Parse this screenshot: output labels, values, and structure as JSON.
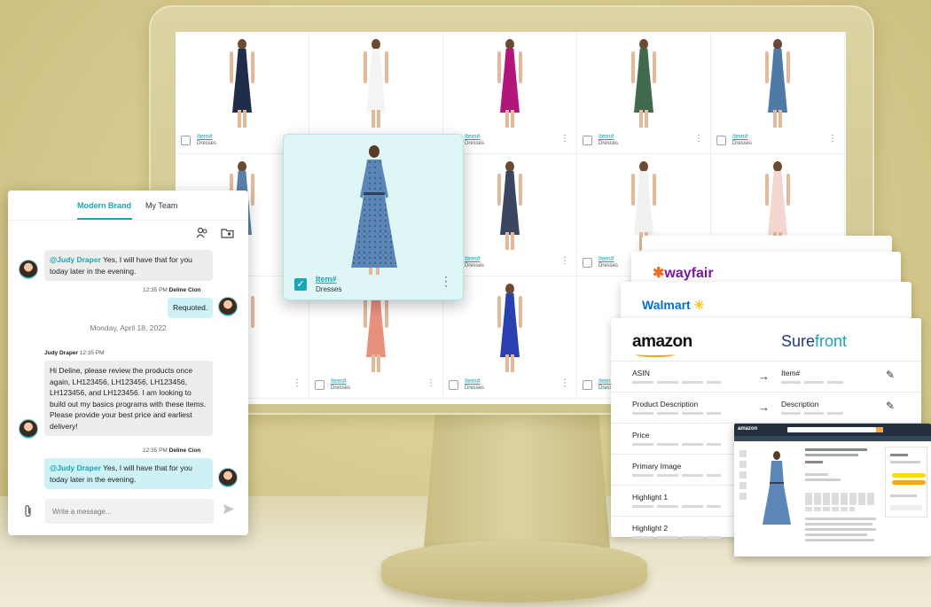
{
  "grid": {
    "tiles": [
      {
        "name": "Item#",
        "category": "Dresses",
        "color": "#1f2d4a",
        "skin": "#e3b99a"
      },
      {
        "name": "Item#",
        "category": "Dresses",
        "color": "#f4f4f2",
        "skin": "#e3b99a"
      },
      {
        "name": "Item#",
        "category": "Dresses",
        "color": "#b3167a",
        "skin": "#e3b99a"
      },
      {
        "name": "Item#",
        "category": "Dresses",
        "color": "#3f6a4e",
        "skin": "#e3b99a"
      },
      {
        "name": "Item#",
        "category": "Dresses",
        "color": "#4f7aa6",
        "skin": "#e3b99a"
      },
      {
        "name": "Item#",
        "category": "Dresses",
        "color": "#5a7fa8",
        "skin": "#e3b99a"
      },
      {
        "name": "Item#",
        "category": "Dresses",
        "color": "#ffffff",
        "skin": "#e3b99a"
      },
      {
        "name": "Item#",
        "category": "Dresses",
        "color": "#3a4660",
        "skin": "#e3b99a"
      },
      {
        "name": "Item#",
        "category": "Dresses",
        "color": "#f1f1ef",
        "skin": "#e3b99a"
      },
      {
        "name": "Item#",
        "category": "Dresses",
        "color": "#f3d6d0",
        "skin": "#e3b99a"
      },
      {
        "name": "Item#",
        "category": "Dresses",
        "color": "#ffffff",
        "skin": "#e3b99a"
      },
      {
        "name": "Item#",
        "category": "Dresses",
        "color": "#e98f7e",
        "skin": "#e3b99a"
      },
      {
        "name": "Item#",
        "category": "Dresses",
        "color": "#2a3fb0",
        "skin": "#e3b99a"
      },
      {
        "name": "Item#",
        "category": "Dresses",
        "color": "#ffffff",
        "skin": "#e3b99a"
      },
      {
        "name": "Item#",
        "category": "Dresses",
        "color": "#ffffff",
        "skin": "#e3b99a"
      }
    ]
  },
  "selected_card": {
    "name": "Item#",
    "category": "Dresses",
    "checked": true
  },
  "chat": {
    "tabs": [
      "Modern Brand",
      "My Team"
    ],
    "active_tab": "Modern Brand",
    "messages": [
      {
        "mention": "@Judy Draper",
        "text": " Yes, I will have that for you today later in the evening."
      },
      {
        "time": "12:35 PM",
        "sender": "Deline Cion",
        "text": "Requoted."
      },
      {
        "date": "Monday, April 18, 2022"
      },
      {
        "sender": "Judy Draper",
        "time": "12:35 PM",
        "text": "Hi Deline, please review the products once again, LH123456, LH123456, LH123456, LH123456, and LH123456. I am looking to build out my basics programs with these items. Please provide your best price and earliest delivery!"
      },
      {
        "time": "12:35 PM",
        "sender": "Deline Cion",
        "mention": "@Judy Draper",
        "text": " Yes, I will have that for you today later in the evening."
      }
    ],
    "input_placeholder": "Write a message..."
  },
  "marketplaces": {
    "wayfair": "wayfair",
    "walmart": "Walmart",
    "amazon": "amazon",
    "surefront_a": "Sure",
    "surefront_b": "front"
  },
  "mapping": [
    {
      "source": "ASIN",
      "target": "Item#"
    },
    {
      "source": "Product Description",
      "target": "Description"
    },
    {
      "source": "Price"
    },
    {
      "source": "Primary Image"
    },
    {
      "source": "Highlight 1"
    },
    {
      "source": "Highlight 2"
    }
  ],
  "preview": {
    "logo": "amazon"
  },
  "colors": {
    "accent": "#1aa6b7",
    "wayfair": "#7b189f",
    "walmart": "#0071ce",
    "amazon_orange": "#f59d00"
  }
}
